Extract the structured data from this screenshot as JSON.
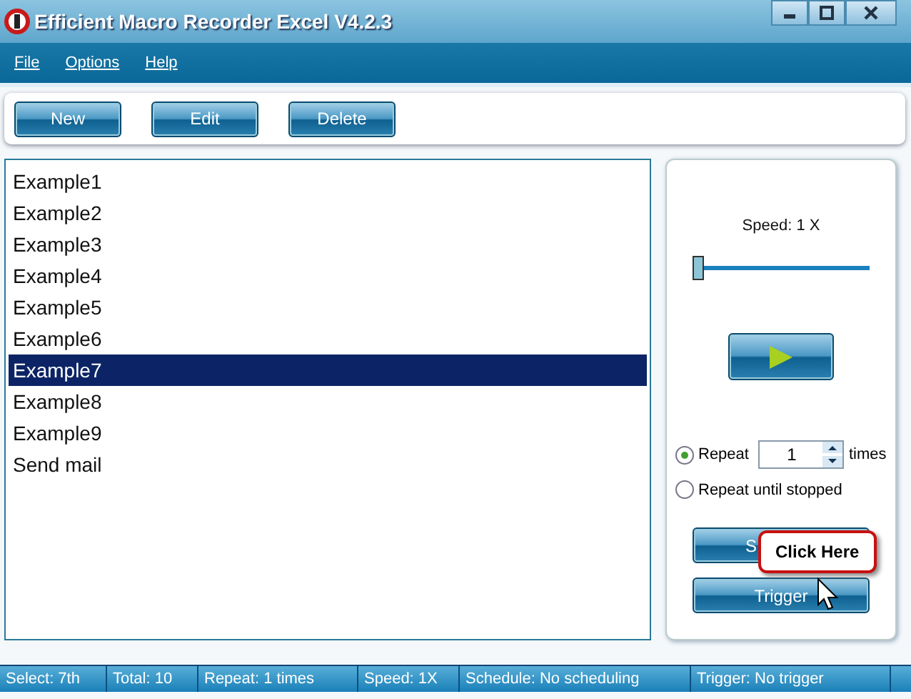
{
  "window": {
    "title": "Efficient Macro Recorder Excel V4.2.3"
  },
  "menu": [
    "File",
    "Options",
    "Help"
  ],
  "toolbar": [
    "New",
    "Edit",
    "Delete"
  ],
  "macros": [
    {
      "label": "Example1",
      "selected": false
    },
    {
      "label": "Example2",
      "selected": false
    },
    {
      "label": "Example3",
      "selected": false
    },
    {
      "label": "Example4",
      "selected": false
    },
    {
      "label": "Example5",
      "selected": false
    },
    {
      "label": "Example6",
      "selected": false
    },
    {
      "label": "Example7",
      "selected": true
    },
    {
      "label": "Example8",
      "selected": false
    },
    {
      "label": "Example9",
      "selected": false
    },
    {
      "label": "Send mail",
      "selected": false
    }
  ],
  "speed": {
    "label": "Speed: 1 X",
    "level": 0
  },
  "repeat": {
    "label": "Repeat",
    "selected": true,
    "value": "1",
    "suffix": "times"
  },
  "repeat_until": {
    "label": "Repeat until stopped",
    "selected": false
  },
  "buttons": [
    "S",
    "Trigger"
  ],
  "callout": "Click Here",
  "status_bar": [
    "Select: 7th",
    "Total: 10",
    "Repeat: 1 times",
    "Speed: 1X",
    "Schedule: No scheduling",
    "Trigger: No trigger"
  ]
}
